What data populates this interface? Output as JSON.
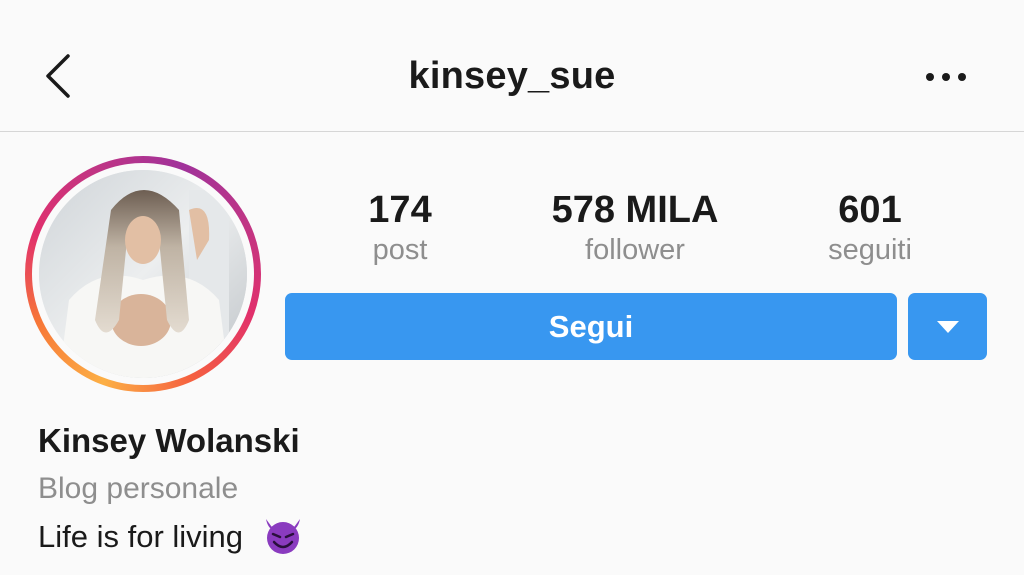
{
  "header": {
    "username": "kinsey_sue",
    "back_icon": "chevron-left-icon",
    "more_icon": "more-horizontal-icon"
  },
  "profile": {
    "avatar_ring_colors": [
      "#fcaf45",
      "#f77737",
      "#e1306c",
      "#c13584",
      "#a0329a"
    ],
    "stats": {
      "posts": {
        "value": "174",
        "label": "post"
      },
      "followers": {
        "value": "578 MILA",
        "label": "follower"
      },
      "following": {
        "value": "601",
        "label": "seguiti"
      }
    },
    "follow_button_label": "Segui",
    "dropdown_icon": "caret-down-icon",
    "full_name": "Kinsey Wolanski",
    "category": "Blog personale",
    "bio_text": "Life is for living",
    "bio_emoji": "smiling-devil-emoji"
  },
  "colors": {
    "accent_blue": "#3897f0",
    "secondary_text": "#8e8e8e",
    "primary_text": "#1a1a1a",
    "background": "#fafafa",
    "emoji_purple": "#8a3bbf"
  }
}
